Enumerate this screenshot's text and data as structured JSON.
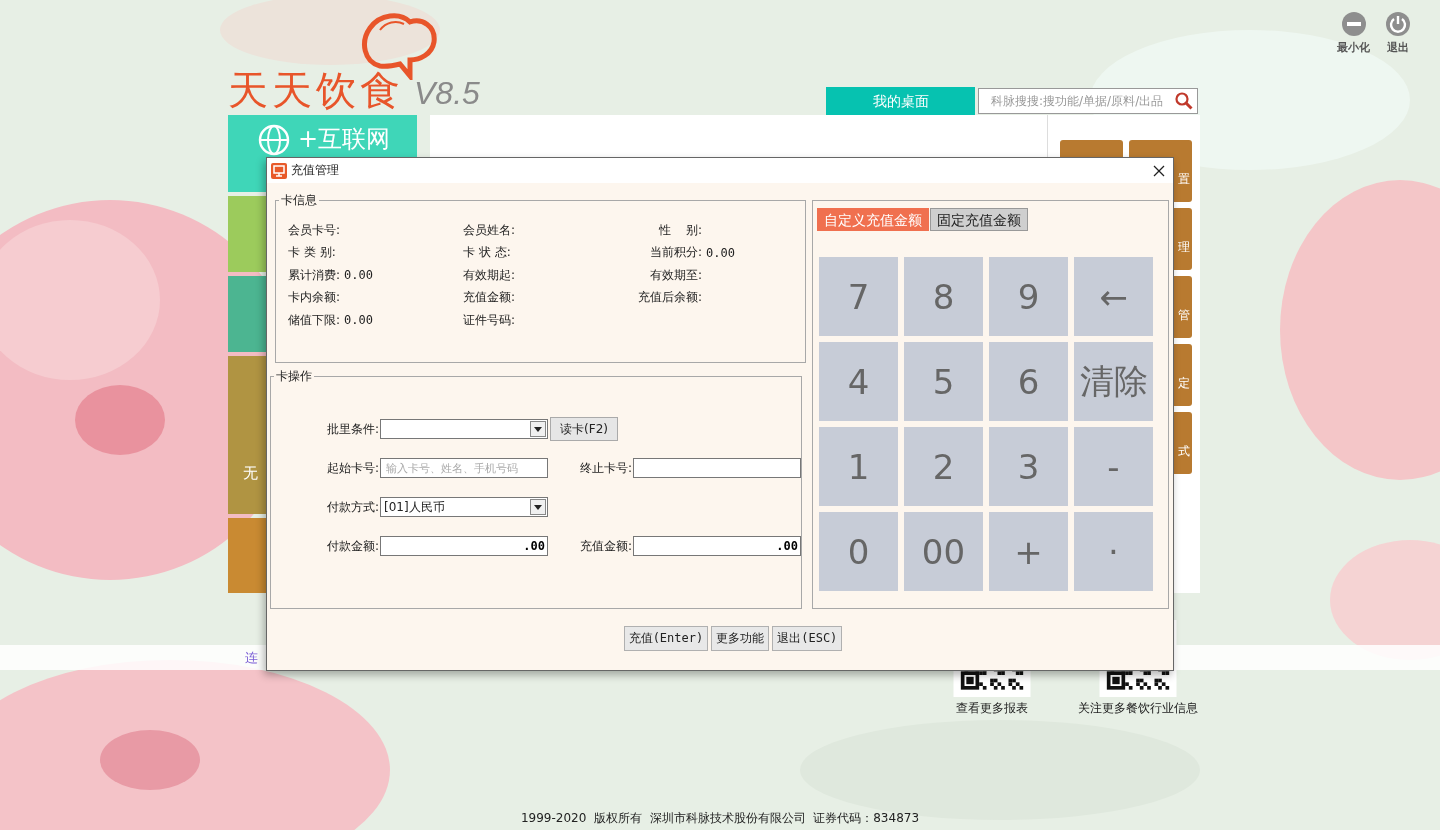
{
  "logo": {
    "name": "天天饮食",
    "version": "V8.5"
  },
  "window_controls": [
    {
      "kind": "minimize",
      "label": "最小化"
    },
    {
      "kind": "exit",
      "label": "退出"
    }
  ],
  "desktop_tab": {
    "label": "我的桌面",
    "selected": true
  },
  "search": {
    "placeholder": "科脉搜搜:搜功能/单据/原料/出品"
  },
  "side_tiles": [
    {
      "kind": "globe",
      "label": "+互联网",
      "color": "#3fd6b8"
    },
    {
      "kind": "plain",
      "color": "#9ccb5c"
    },
    {
      "kind": "plain",
      "color": "#4cb591"
    },
    {
      "kind": "plain",
      "label": "无",
      "color": "#b09442"
    },
    {
      "kind": "plain",
      "color": "#c98a32"
    }
  ],
  "shortcut_tiles": [
    {
      "label": "置"
    },
    {
      "label": "理"
    },
    {
      "label": "管"
    },
    {
      "label": "定"
    },
    {
      "label": "式"
    }
  ],
  "bottom_link": "连",
  "qr_codes": [
    {
      "caption": "查看更多报表"
    },
    {
      "caption": "关注更多餐饮行业信息"
    }
  ],
  "footer": "1999-2020  版权所有  深圳市科脉技术股份有限公司  证券代码：834873",
  "dialog": {
    "title": "充值管理",
    "card_info": {
      "title": "卡信息",
      "fields": [
        {
          "label": "会员卡号:"
        },
        {
          "label": "会员姓名:"
        },
        {
          "label": "性    别:"
        },
        {
          "label": "卡 类 别:"
        },
        {
          "label": "卡 状 态:"
        },
        {
          "label": "当前积分:",
          "value": "0.00"
        },
        {
          "label": "累计消费:",
          "value": "0.00"
        },
        {
          "label": "有效期起:"
        },
        {
          "label": "有效期至:"
        },
        {
          "label": "卡内余额:"
        },
        {
          "label": "充值金额:"
        },
        {
          "label": "充值后余额:"
        },
        {
          "label": "储值下限:",
          "value": "0.00"
        },
        {
          "label": "证件号码:"
        }
      ]
    },
    "card_ops": {
      "title": "卡操作",
      "rows": [
        [
          {
            "kind": "select",
            "label": "批里条件:"
          },
          {
            "kind": "button",
            "label": "读卡(F2)"
          }
        ],
        [
          {
            "kind": "input",
            "label": "起始卡号:",
            "placeholder": "输入卡号、姓名、手机号码"
          },
          {
            "kind": "input",
            "label": "终止卡号:"
          }
        ],
        [
          {
            "kind": "select",
            "label": "付款方式:",
            "value": "[01]人民币"
          }
        ],
        [
          {
            "kind": "input",
            "label": "付款金额:",
            "value": ".00"
          },
          {
            "kind": "input",
            "label": "充值金额:",
            "value": ".00"
          }
        ]
      ]
    },
    "keypad": {
      "tabs": [
        {
          "label": "自定义充值金额",
          "selected": true
        },
        {
          "label": "固定充值金额",
          "selected": false
        }
      ],
      "keys": [
        "7",
        "8",
        "9",
        "←",
        "4",
        "5",
        "6",
        "清除",
        "1",
        "2",
        "3",
        "-",
        "0",
        "00",
        "+",
        "·"
      ]
    },
    "buttons": [
      "充值(Enter)",
      "更多功能",
      "退出(ESC)"
    ]
  }
}
